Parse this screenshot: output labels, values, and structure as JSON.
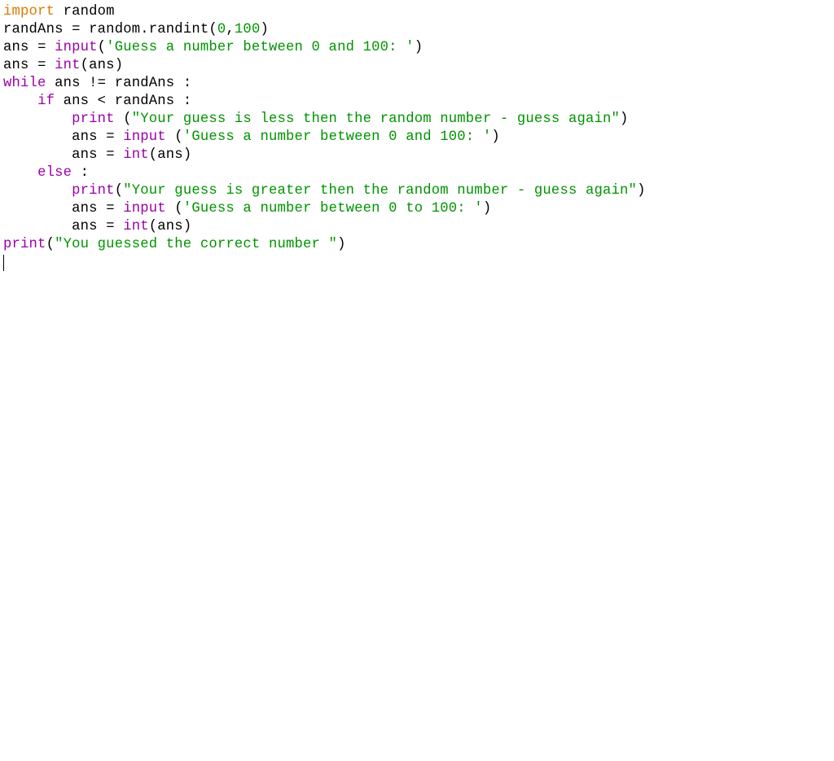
{
  "colors": {
    "keyword_import": "#d97b00",
    "keyword_flow": "#9b00a8",
    "builtin": "#9b00a8",
    "identifier": "#000000",
    "punct": "#000000",
    "number": "#009300",
    "string": "#009300"
  },
  "code": [
    [
      {
        "c": "keyword_import",
        "t": "import"
      },
      {
        "c": "identifier",
        "t": " random"
      }
    ],
    [
      {
        "c": "identifier",
        "t": "randAns "
      },
      {
        "c": "punct",
        "t": "= "
      },
      {
        "c": "identifier",
        "t": "random"
      },
      {
        "c": "punct",
        "t": "."
      },
      {
        "c": "identifier",
        "t": "randint"
      },
      {
        "c": "punct",
        "t": "("
      },
      {
        "c": "number",
        "t": "0"
      },
      {
        "c": "punct",
        "t": ","
      },
      {
        "c": "number",
        "t": "100"
      },
      {
        "c": "punct",
        "t": ")"
      }
    ],
    [
      {
        "c": "identifier",
        "t": "ans "
      },
      {
        "c": "punct",
        "t": "= "
      },
      {
        "c": "builtin",
        "t": "input"
      },
      {
        "c": "punct",
        "t": "("
      },
      {
        "c": "string",
        "t": "'Guess a number between 0 and 100: '"
      },
      {
        "c": "punct",
        "t": ")"
      }
    ],
    [
      {
        "c": "identifier",
        "t": "ans "
      },
      {
        "c": "punct",
        "t": "= "
      },
      {
        "c": "builtin",
        "t": "int"
      },
      {
        "c": "punct",
        "t": "("
      },
      {
        "c": "identifier",
        "t": "ans"
      },
      {
        "c": "punct",
        "t": ")"
      }
    ],
    [
      {
        "c": "keyword_flow",
        "t": "while"
      },
      {
        "c": "identifier",
        "t": " ans "
      },
      {
        "c": "punct",
        "t": "!= "
      },
      {
        "c": "identifier",
        "t": "randAns "
      },
      {
        "c": "punct",
        "t": ":"
      }
    ],
    [
      {
        "c": "punct",
        "t": "    "
      },
      {
        "c": "keyword_flow",
        "t": "if"
      },
      {
        "c": "identifier",
        "t": " ans "
      },
      {
        "c": "punct",
        "t": "< "
      },
      {
        "c": "identifier",
        "t": "randAns "
      },
      {
        "c": "punct",
        "t": ":"
      }
    ],
    [
      {
        "c": "punct",
        "t": "        "
      },
      {
        "c": "builtin",
        "t": "print"
      },
      {
        "c": "punct",
        "t": " ("
      },
      {
        "c": "string",
        "t": "\"Your guess is less then the random number - guess again\""
      },
      {
        "c": "punct",
        "t": ")"
      }
    ],
    [
      {
        "c": "punct",
        "t": "        "
      },
      {
        "c": "identifier",
        "t": "ans "
      },
      {
        "c": "punct",
        "t": "= "
      },
      {
        "c": "builtin",
        "t": "input"
      },
      {
        "c": "punct",
        "t": " ("
      },
      {
        "c": "string",
        "t": "'Guess a number between 0 and 100: '"
      },
      {
        "c": "punct",
        "t": ")"
      }
    ],
    [
      {
        "c": "punct",
        "t": "        "
      },
      {
        "c": "identifier",
        "t": "ans "
      },
      {
        "c": "punct",
        "t": "= "
      },
      {
        "c": "builtin",
        "t": "int"
      },
      {
        "c": "punct",
        "t": "("
      },
      {
        "c": "identifier",
        "t": "ans"
      },
      {
        "c": "punct",
        "t": ")"
      }
    ],
    [
      {
        "c": "punct",
        "t": "    "
      },
      {
        "c": "keyword_flow",
        "t": "else"
      },
      {
        "c": "punct",
        "t": " :"
      }
    ],
    [
      {
        "c": "punct",
        "t": "        "
      },
      {
        "c": "builtin",
        "t": "print"
      },
      {
        "c": "punct",
        "t": "("
      },
      {
        "c": "string",
        "t": "\"Your guess is greater then the random number - guess again\""
      },
      {
        "c": "punct",
        "t": ")"
      }
    ],
    [
      {
        "c": "punct",
        "t": "        "
      },
      {
        "c": "identifier",
        "t": "ans "
      },
      {
        "c": "punct",
        "t": "= "
      },
      {
        "c": "builtin",
        "t": "input"
      },
      {
        "c": "punct",
        "t": " ("
      },
      {
        "c": "string",
        "t": "'Guess a number between 0 to 100: '"
      },
      {
        "c": "punct",
        "t": ")"
      }
    ],
    [
      {
        "c": "punct",
        "t": "        "
      },
      {
        "c": "identifier",
        "t": "ans "
      },
      {
        "c": "punct",
        "t": "= "
      },
      {
        "c": "builtin",
        "t": "int"
      },
      {
        "c": "punct",
        "t": "("
      },
      {
        "c": "identifier",
        "t": "ans"
      },
      {
        "c": "punct",
        "t": ")"
      }
    ],
    [
      {
        "c": "builtin",
        "t": "print"
      },
      {
        "c": "punct",
        "t": "("
      },
      {
        "c": "string",
        "t": "\"You guessed the correct number \""
      },
      {
        "c": "punct",
        "t": ")"
      }
    ]
  ]
}
